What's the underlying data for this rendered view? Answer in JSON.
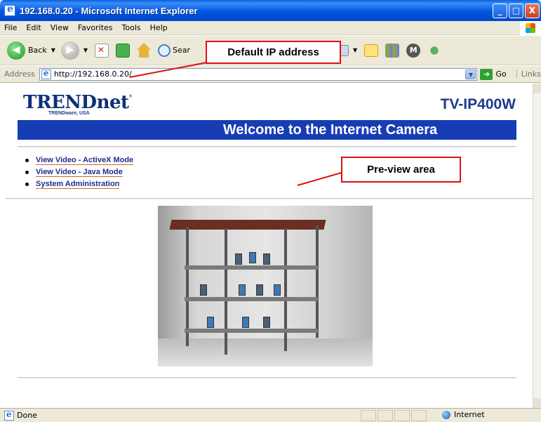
{
  "window": {
    "title": "192.168.0.20 - Microsoft Internet Explorer",
    "buttons": {
      "minimize": "_",
      "maximize": "□",
      "close": "X"
    }
  },
  "menu": [
    "File",
    "Edit",
    "View",
    "Favorites",
    "Tools",
    "Help"
  ],
  "toolbar": {
    "back_label": "Back",
    "search_label": "Sear"
  },
  "address_bar": {
    "label": "Address",
    "url": "http://192.168.0.20/",
    "go_label": "Go",
    "links_label": "Links"
  },
  "page": {
    "brand": "TRENDnet",
    "brand_tagline": "TRENDware, USA",
    "brand_reg": "®",
    "model": "TV-IP400W",
    "welcome": "Welcome to the Internet Camera",
    "nav_links": [
      "View Video - ActiveX Mode",
      "View Video - Java Mode",
      "System Administration"
    ]
  },
  "status_bar": {
    "text": "Done",
    "zone": "Internet"
  },
  "annotations": {
    "ip_callout": "Default IP address",
    "preview_callout": "Pre-view area",
    "color": "#dd1111"
  },
  "colors": {
    "title_bar": "#0056e0",
    "welcome_bar": "#173db5",
    "brand": "#0f2f7a",
    "link": "#1f2c8a"
  }
}
